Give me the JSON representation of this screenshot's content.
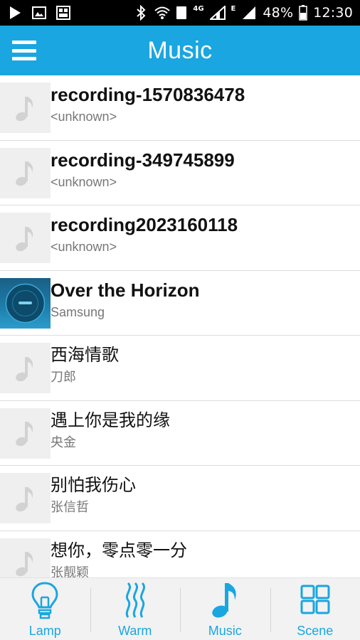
{
  "status_bar": {
    "network_type": "4G",
    "network_type_2": "E",
    "sim_slot": "1",
    "battery": "48%",
    "time": "12:30"
  },
  "app_bar": {
    "title": "Music"
  },
  "songs": [
    {
      "title": "recording-1570836478",
      "artist": "<unknown>",
      "art": "note"
    },
    {
      "title": "recording-349745899",
      "artist": "<unknown>",
      "art": "note"
    },
    {
      "title": "recording2023160118",
      "artist": "<unknown>",
      "art": "album"
    },
    {
      "title": "Over the Horizon",
      "artist": "Samsung",
      "art": "album"
    },
    {
      "title": "西海情歌",
      "artist": "刀郎",
      "art": "note"
    },
    {
      "title": "遇上你是我的缘",
      "artist": "央金",
      "art": "note"
    },
    {
      "title": "别怕我伤心",
      "artist": "张信哲",
      "art": "note"
    },
    {
      "title": "想你，零点零一分",
      "artist": "张靓颖",
      "art": "note"
    }
  ],
  "bottom_nav": {
    "lamp": "Lamp",
    "warm": "Warm",
    "music": "Music",
    "scene": "Scene"
  },
  "colors": {
    "accent": "#1aa6e0",
    "title_text": "#111111",
    "subtitle_text": "#777777"
  }
}
